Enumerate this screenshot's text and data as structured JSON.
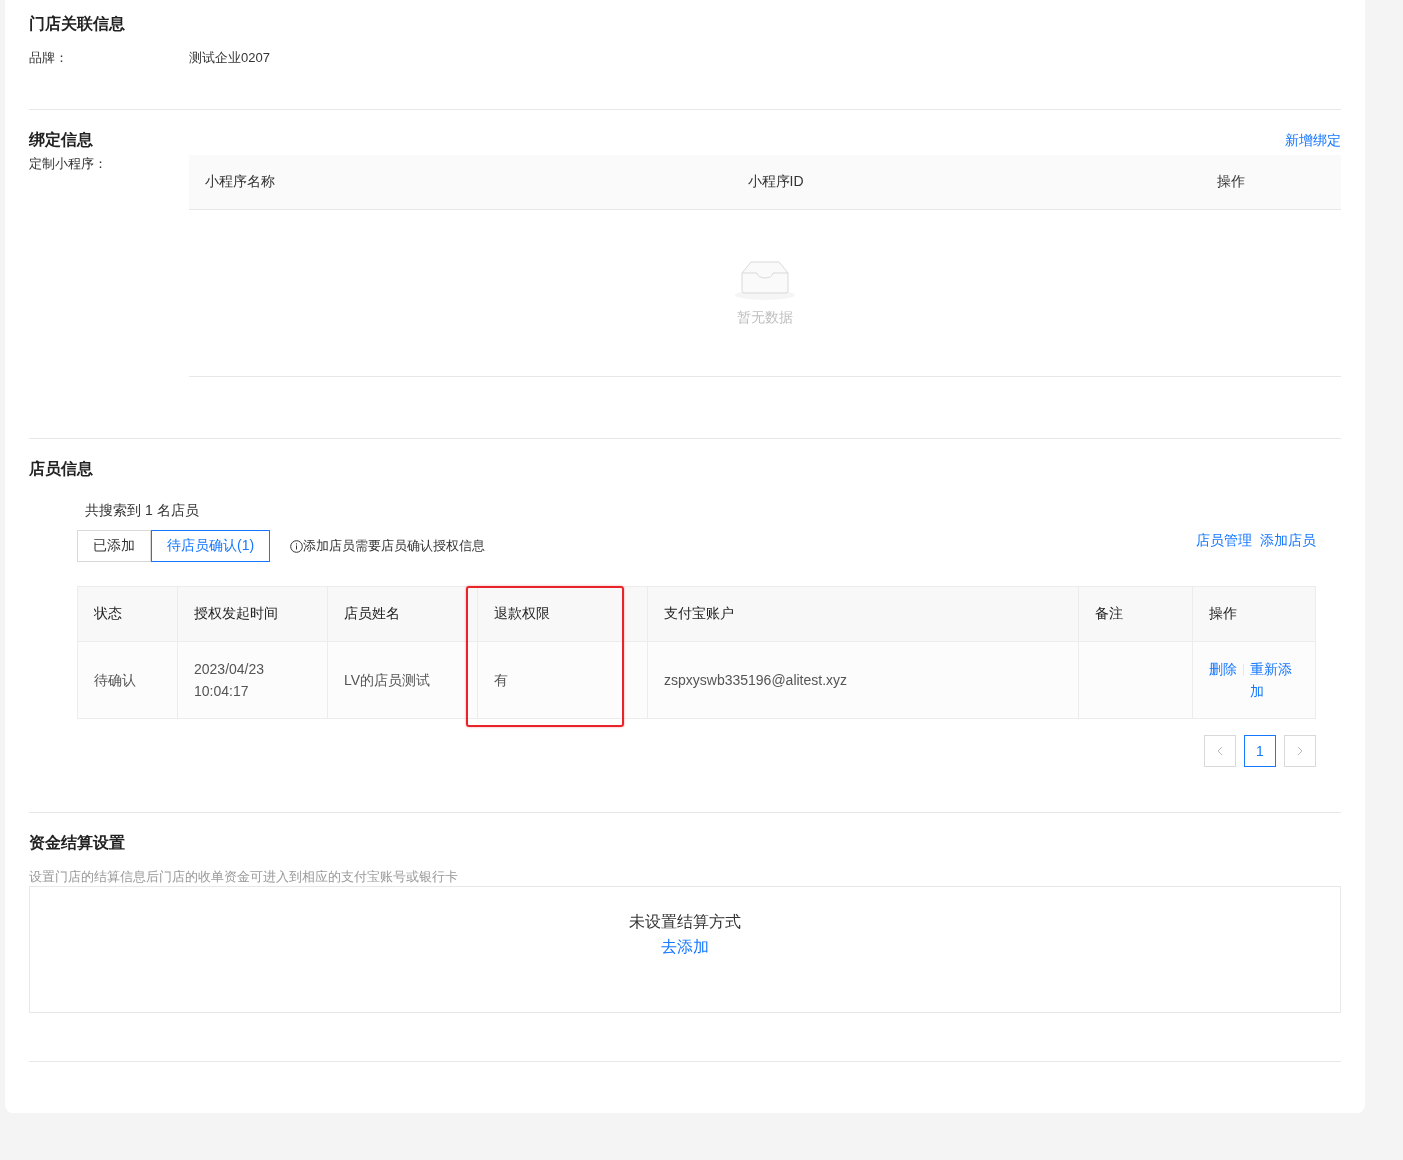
{
  "store_info": {
    "title": "门店关联信息",
    "fields": [
      {
        "label": "品牌：",
        "value": "测试企业0207"
      }
    ]
  },
  "binding": {
    "title": "绑定信息",
    "action": "新增绑定",
    "label": "定制小程序：",
    "table": {
      "columns": [
        "小程序名称",
        "小程序ID",
        "操作"
      ],
      "empty_text": "暂无数据"
    }
  },
  "staff": {
    "title": "店员信息",
    "count_text": "共搜索到 1 名店员",
    "tabs": [
      {
        "label": "已添加",
        "selected": false
      },
      {
        "label": "待店员确认(1)",
        "selected": true
      }
    ],
    "notice": "添加店员需要店员确认授权信息",
    "links": [
      "店员管理",
      "添加店员"
    ],
    "table": {
      "columns": [
        {
          "label": "状态",
          "highlighted": false
        },
        {
          "label": "授权发起时间",
          "highlighted": false
        },
        {
          "label": "店员姓名",
          "highlighted": false
        },
        {
          "label": "退款权限",
          "highlighted": true
        },
        {
          "label": "支付宝账户",
          "highlighted": false
        },
        {
          "label": "备注",
          "highlighted": false
        },
        {
          "label": "操作",
          "highlighted": false
        }
      ],
      "rows": [
        {
          "cells": [
            "待确认",
            "2023/04/23 10:04:17",
            "LV的店员测试",
            "有",
            "zspxyswb335196@alitest.xyz",
            ""
          ],
          "actions": [
            "删除",
            "重新添加"
          ]
        }
      ]
    },
    "pagination": {
      "pages": [
        {
          "label": "1",
          "selected": true
        }
      ]
    }
  },
  "settlement": {
    "title": "资金结算设置",
    "description": "设置门店的结算信息后门店的收单资金可进入到相应的支付宝账号或银行卡",
    "empty_text": "未设置结算方式",
    "action": "去添加"
  }
}
